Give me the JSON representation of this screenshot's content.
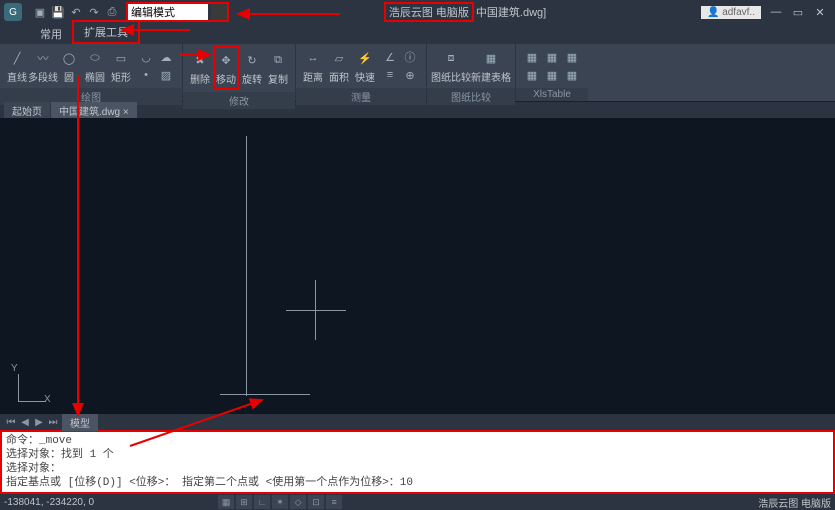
{
  "titlebar": {
    "search_value": "编辑模式",
    "app_name_1": "浩辰云图",
    "app_name_2": "电脑版",
    "doc_suffix": "中国建筑.dwg]",
    "user": "adfavf..",
    "min": "—",
    "max": "▭",
    "close": "✕"
  },
  "tabs": {
    "common": "常用",
    "ext": "扩展工具"
  },
  "ribbon": {
    "draw": {
      "line": "直线",
      "pline": "多段线",
      "circle": "圆",
      "ellipse": "椭圆",
      "rect": "矩形",
      "title": "绘图"
    },
    "modify": {
      "erase": "删除",
      "move": "移动",
      "rotate": "旋转",
      "copy": "复制",
      "title": "修改"
    },
    "measure": {
      "dist": "距离",
      "area": "面积",
      "quick": "快速",
      "title": "测量"
    },
    "compare": {
      "dwgcmp": "图纸比较",
      "newtbl": "新建表格",
      "title": "图纸比较",
      "xlstable": "XlsTable"
    }
  },
  "doctabs": {
    "start": "起始页",
    "doc": "中国建筑.dwg"
  },
  "ucs": {
    "y": "Y",
    "x": "X"
  },
  "modeltabs": {
    "model": "模型"
  },
  "cmd": {
    "l1": "命令：_move",
    "l2": "选择对象：找到 1 个",
    "l3": "选择对象：",
    "l4": "指定基点或 [位移(D)] <位移>：  指定第二个点或 <使用第一个点作为位移>：10"
  },
  "status": {
    "coords": "-138041, -234220, 0",
    "brand": "浩辰云图 电脑版"
  }
}
